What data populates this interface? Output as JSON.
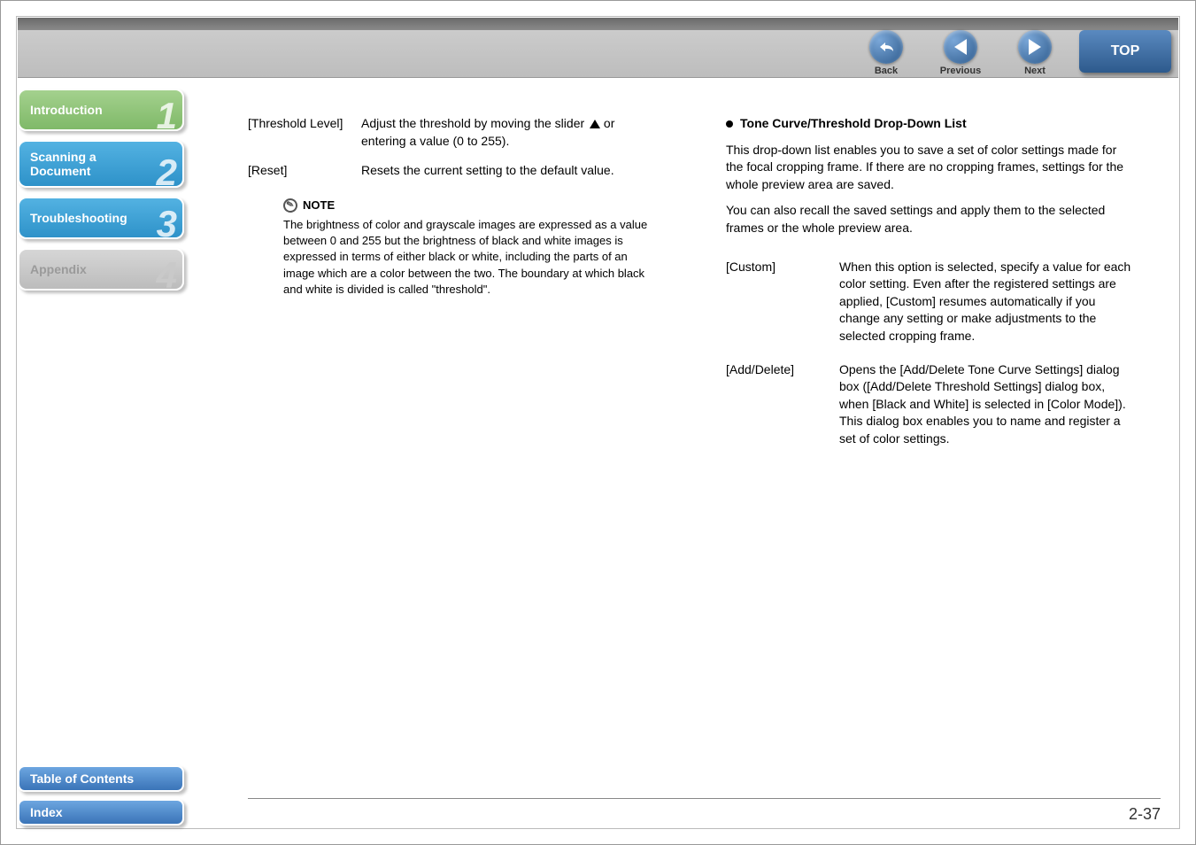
{
  "topnav": {
    "back": "Back",
    "previous": "Previous",
    "next": "Next",
    "top": "TOP"
  },
  "sidebar": {
    "items": [
      {
        "label": "Introduction",
        "num": "1"
      },
      {
        "label": "Scanning a Document",
        "num": "2"
      },
      {
        "label": "Troubleshooting",
        "num": "3"
      },
      {
        "label": "Appendix",
        "num": "4"
      }
    ],
    "bottom": {
      "toc": "Table of Contents",
      "index": "Index"
    }
  },
  "content": {
    "left": {
      "defs": [
        {
          "term": "[Threshold Level]",
          "desc_a": "Adjust the threshold by moving the slider ",
          "desc_b": " or entering a value (0 to 255)."
        },
        {
          "term": "[Reset]",
          "desc": "Resets the current setting to the default value."
        }
      ],
      "note_label": "NOTE",
      "note_text": "The brightness of color and grayscale images are expressed as a value between 0 and 255 but the brightness of black and white images is expressed in terms of either black or white, including the parts of an image which are a color between the two. The boundary at which black and white is divided is called \"threshold\"."
    },
    "right": {
      "heading": "Tone Curve/Threshold Drop-Down List",
      "para1": "This drop-down list enables you to save a set of color settings made for the focal cropping frame. If there are no cropping frames, settings for the whole preview area are saved.",
      "para2": "You can also recall the saved settings and apply them to the selected frames or the whole preview area.",
      "defs": [
        {
          "term": "[Custom]",
          "desc": "When this option is selected, specify a value for each color setting. Even after the registered settings are applied, [Custom] resumes automatically if you change any setting or make adjustments to the selected cropping frame."
        },
        {
          "term": "[Add/Delete]",
          "desc": "Opens the [Add/Delete Tone Curve Settings] dialog box ([Add/Delete Threshold Settings] dialog box, when [Black and White] is selected in [Color Mode]). This dialog box enables you to name and register a set of color settings."
        }
      ]
    }
  },
  "page_number": "2-37"
}
